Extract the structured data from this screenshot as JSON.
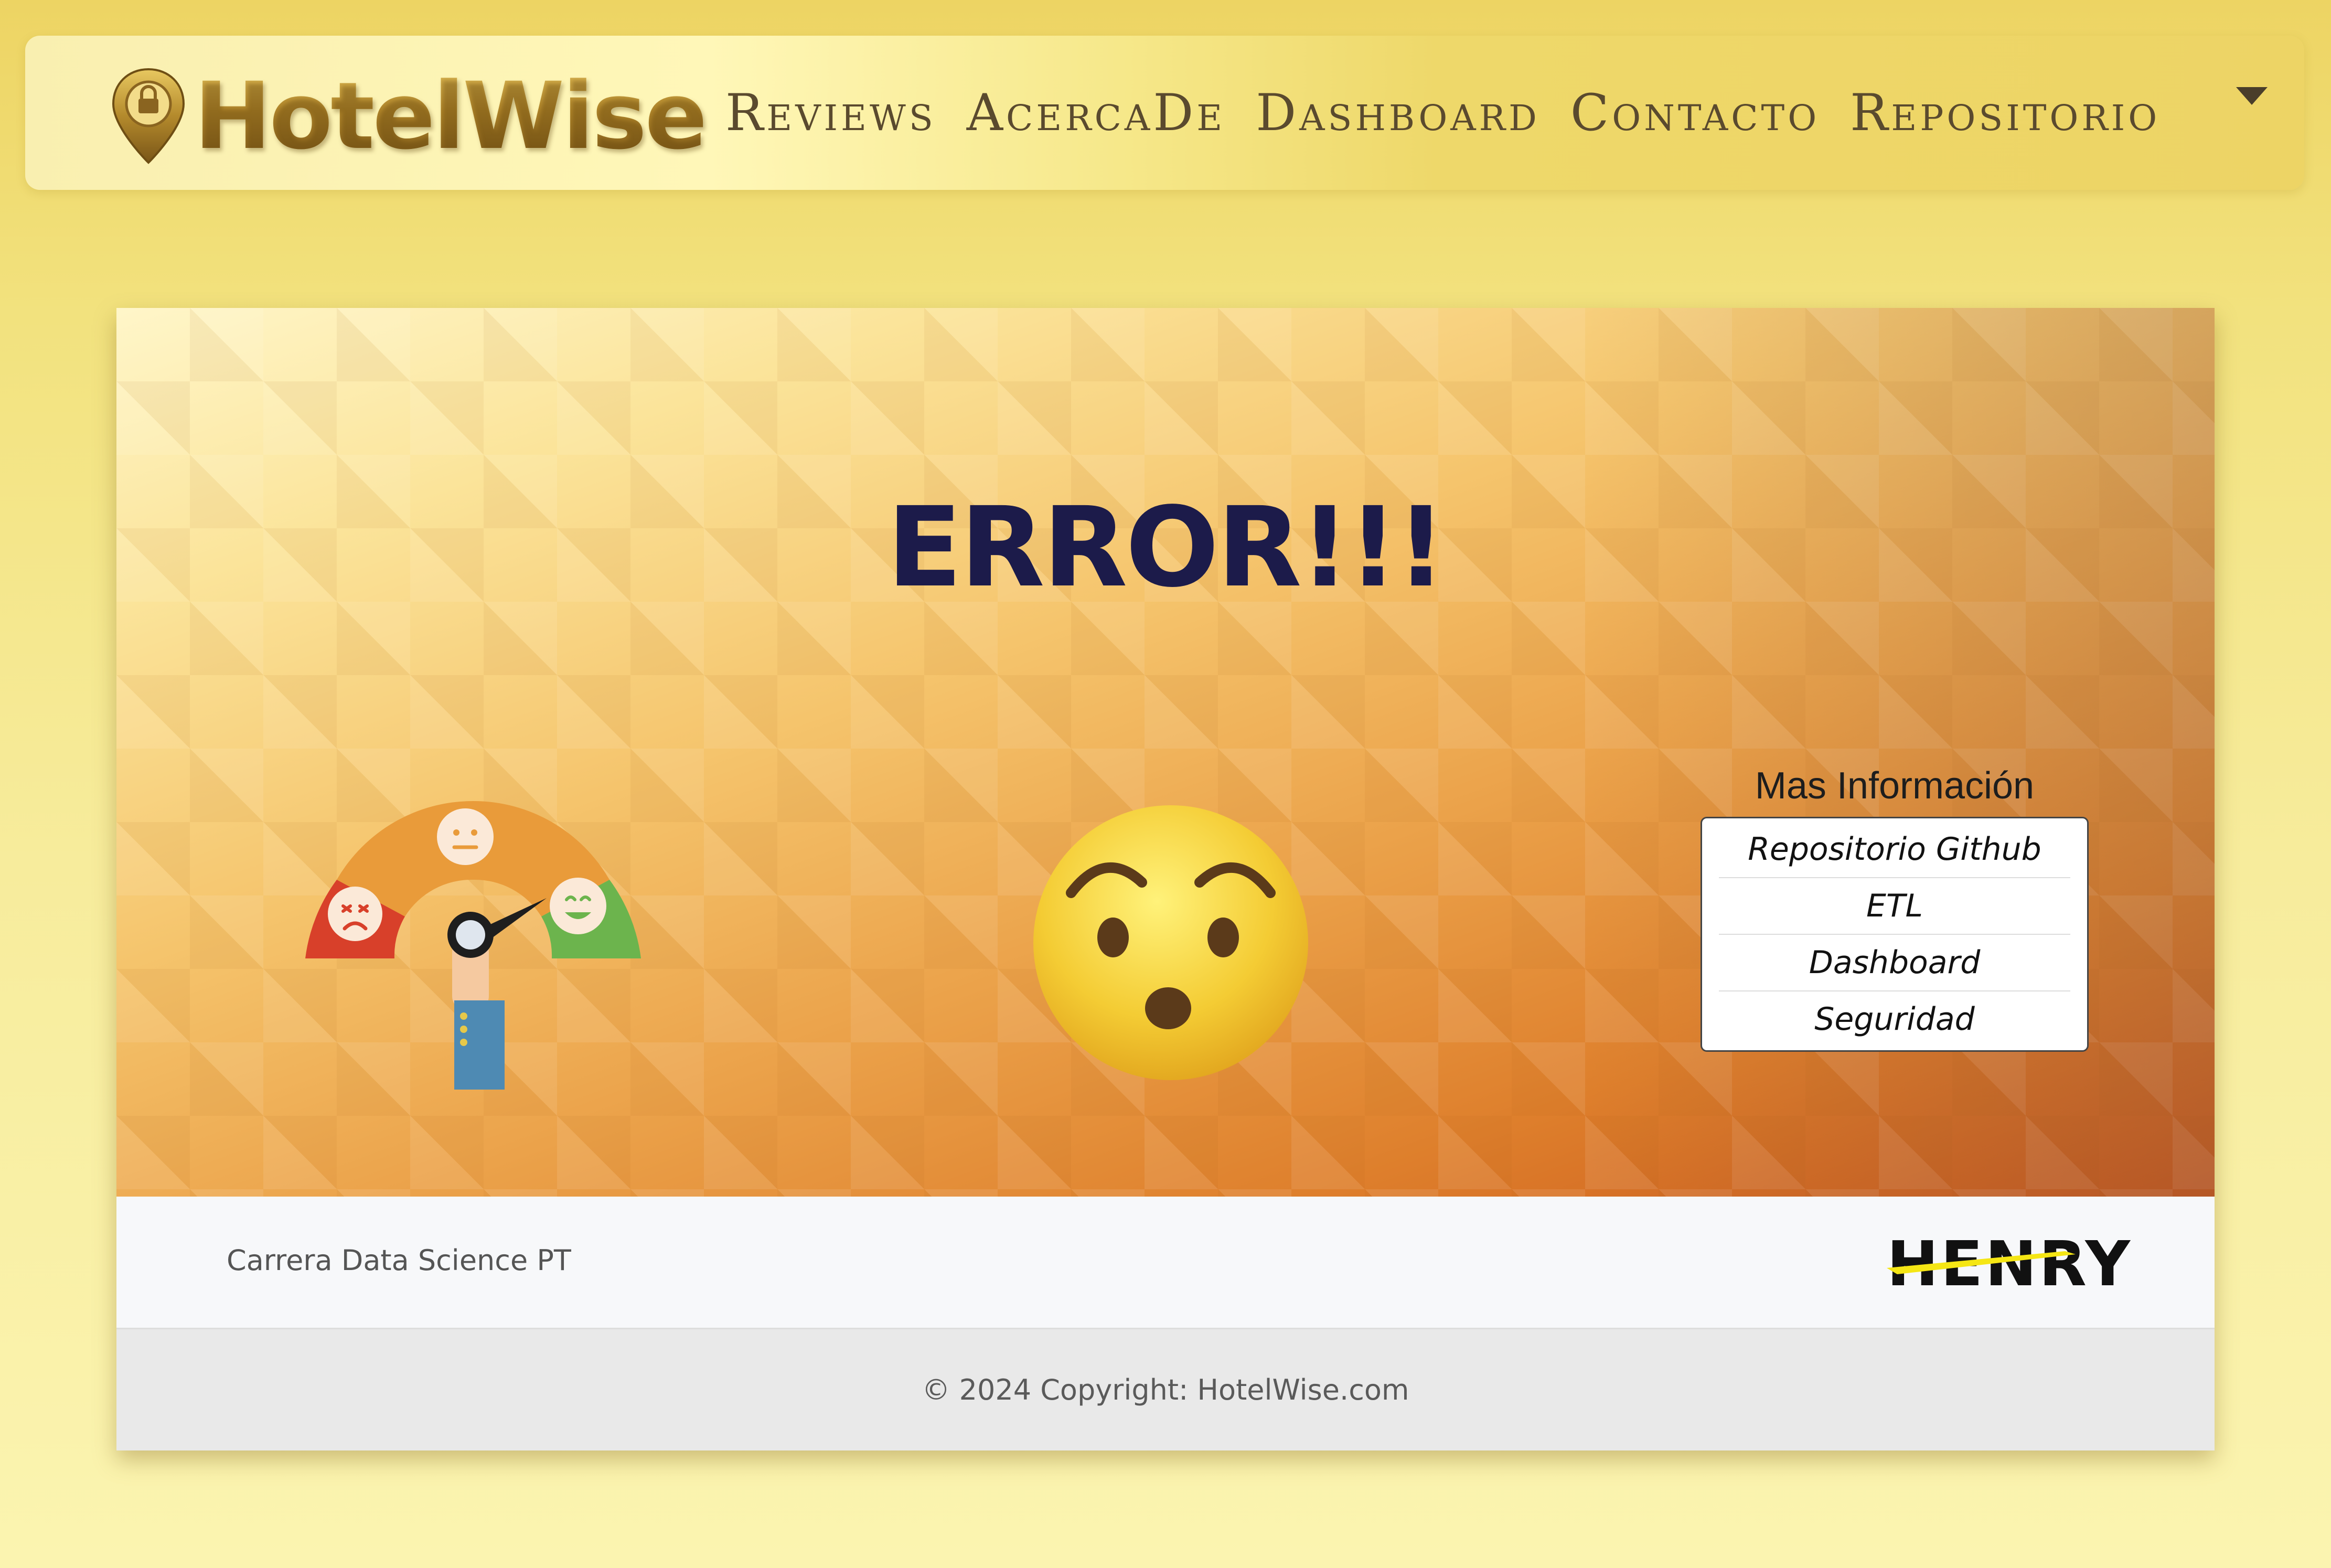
{
  "brand": {
    "name": "HotelWise"
  },
  "nav": {
    "links": [
      "Reviews",
      "AcercaDe",
      "Dashboard",
      "Contacto",
      "Repositorio"
    ],
    "dropdown_icon": "caret-down"
  },
  "hero": {
    "title": "ERROR!!!",
    "illustration": "satisfaction-meter",
    "emoji": "hushed-face"
  },
  "info_panel": {
    "title": "Mas Información",
    "links": [
      "Repositorio Github",
      "ETL",
      "Dashboard",
      "Seguridad"
    ]
  },
  "footer": {
    "career": "Carrera Data Science PT",
    "logo": "HENRY",
    "copyright": "© 2024 Copyright: HotelWise.com"
  },
  "colors": {
    "navbar_gold": "#edd465",
    "title_navy": "#1c1b4a",
    "nav_text": "#5a4a2e",
    "henry_yellow": "#f5e614"
  }
}
